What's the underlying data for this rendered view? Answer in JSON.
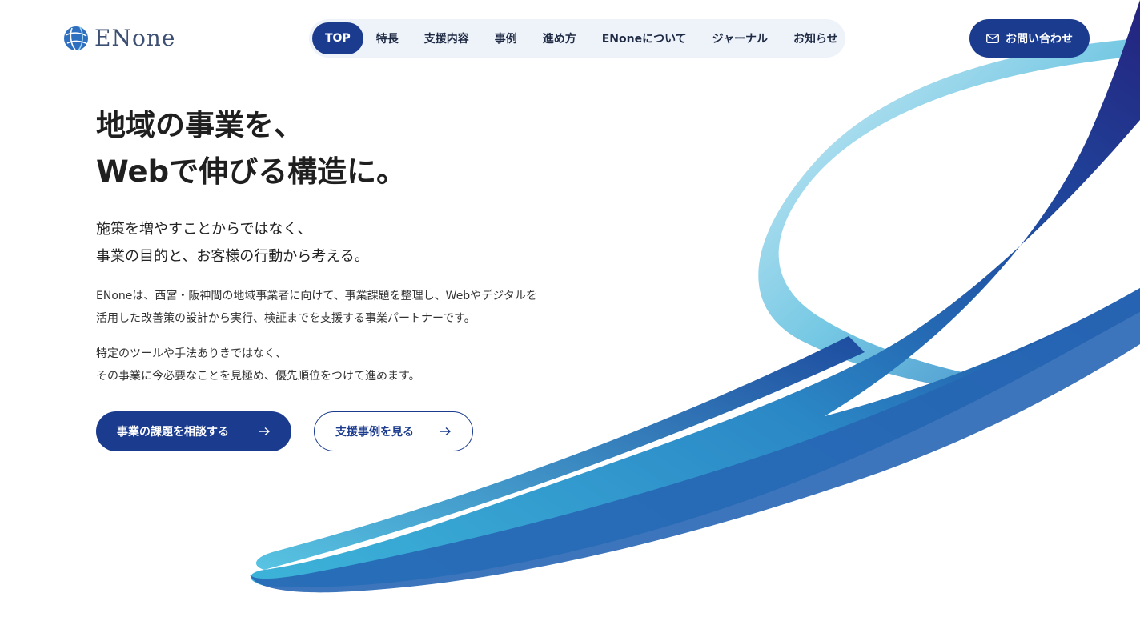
{
  "brand": {
    "name": "ENone",
    "logo_icon": "globe-logo-icon"
  },
  "nav": {
    "items": [
      {
        "label": "TOP",
        "active": true
      },
      {
        "label": "特長",
        "active": false
      },
      {
        "label": "支援内容",
        "active": false
      },
      {
        "label": "事例",
        "active": false
      },
      {
        "label": "進め方",
        "active": false
      },
      {
        "label": "ENoneについて",
        "active": false
      },
      {
        "label": "ジャーナル",
        "active": false
      },
      {
        "label": "お知らせ",
        "active": false
      }
    ]
  },
  "contact": {
    "label": "お問い合わせ",
    "icon": "mail-icon"
  },
  "hero": {
    "headline_line1": "地域の事業を、",
    "headline_line2": "Webで伸びる構造に。",
    "subhead_line1": "施策を増やすことからではなく、",
    "subhead_line2": "事業の目的と、お客様の行動から考える。",
    "body1_line1": "ENoneは、西宮・阪神間の地域事業者に向けて、事業課題を整理し、Webやデジタルを",
    "body1_line2": "活用した改善策の設計から実行、検証までを支援する事業パートナーです。",
    "body2_line1": "特定のツールや手法ありきではなく、",
    "body2_line2": "その事業に今必要なことを見極め、優先順位をつけて進めます。"
  },
  "cta": {
    "primary_label": "事業の課題を相談する",
    "secondary_label": "支援事例を見る",
    "arrow_icon": "arrow-right-icon"
  },
  "colors": {
    "brand_navy": "#1b3b8f",
    "nav_bg": "#eef3fa",
    "ribbon_light": "#4fc3e0",
    "ribbon_dark": "#232a86"
  }
}
